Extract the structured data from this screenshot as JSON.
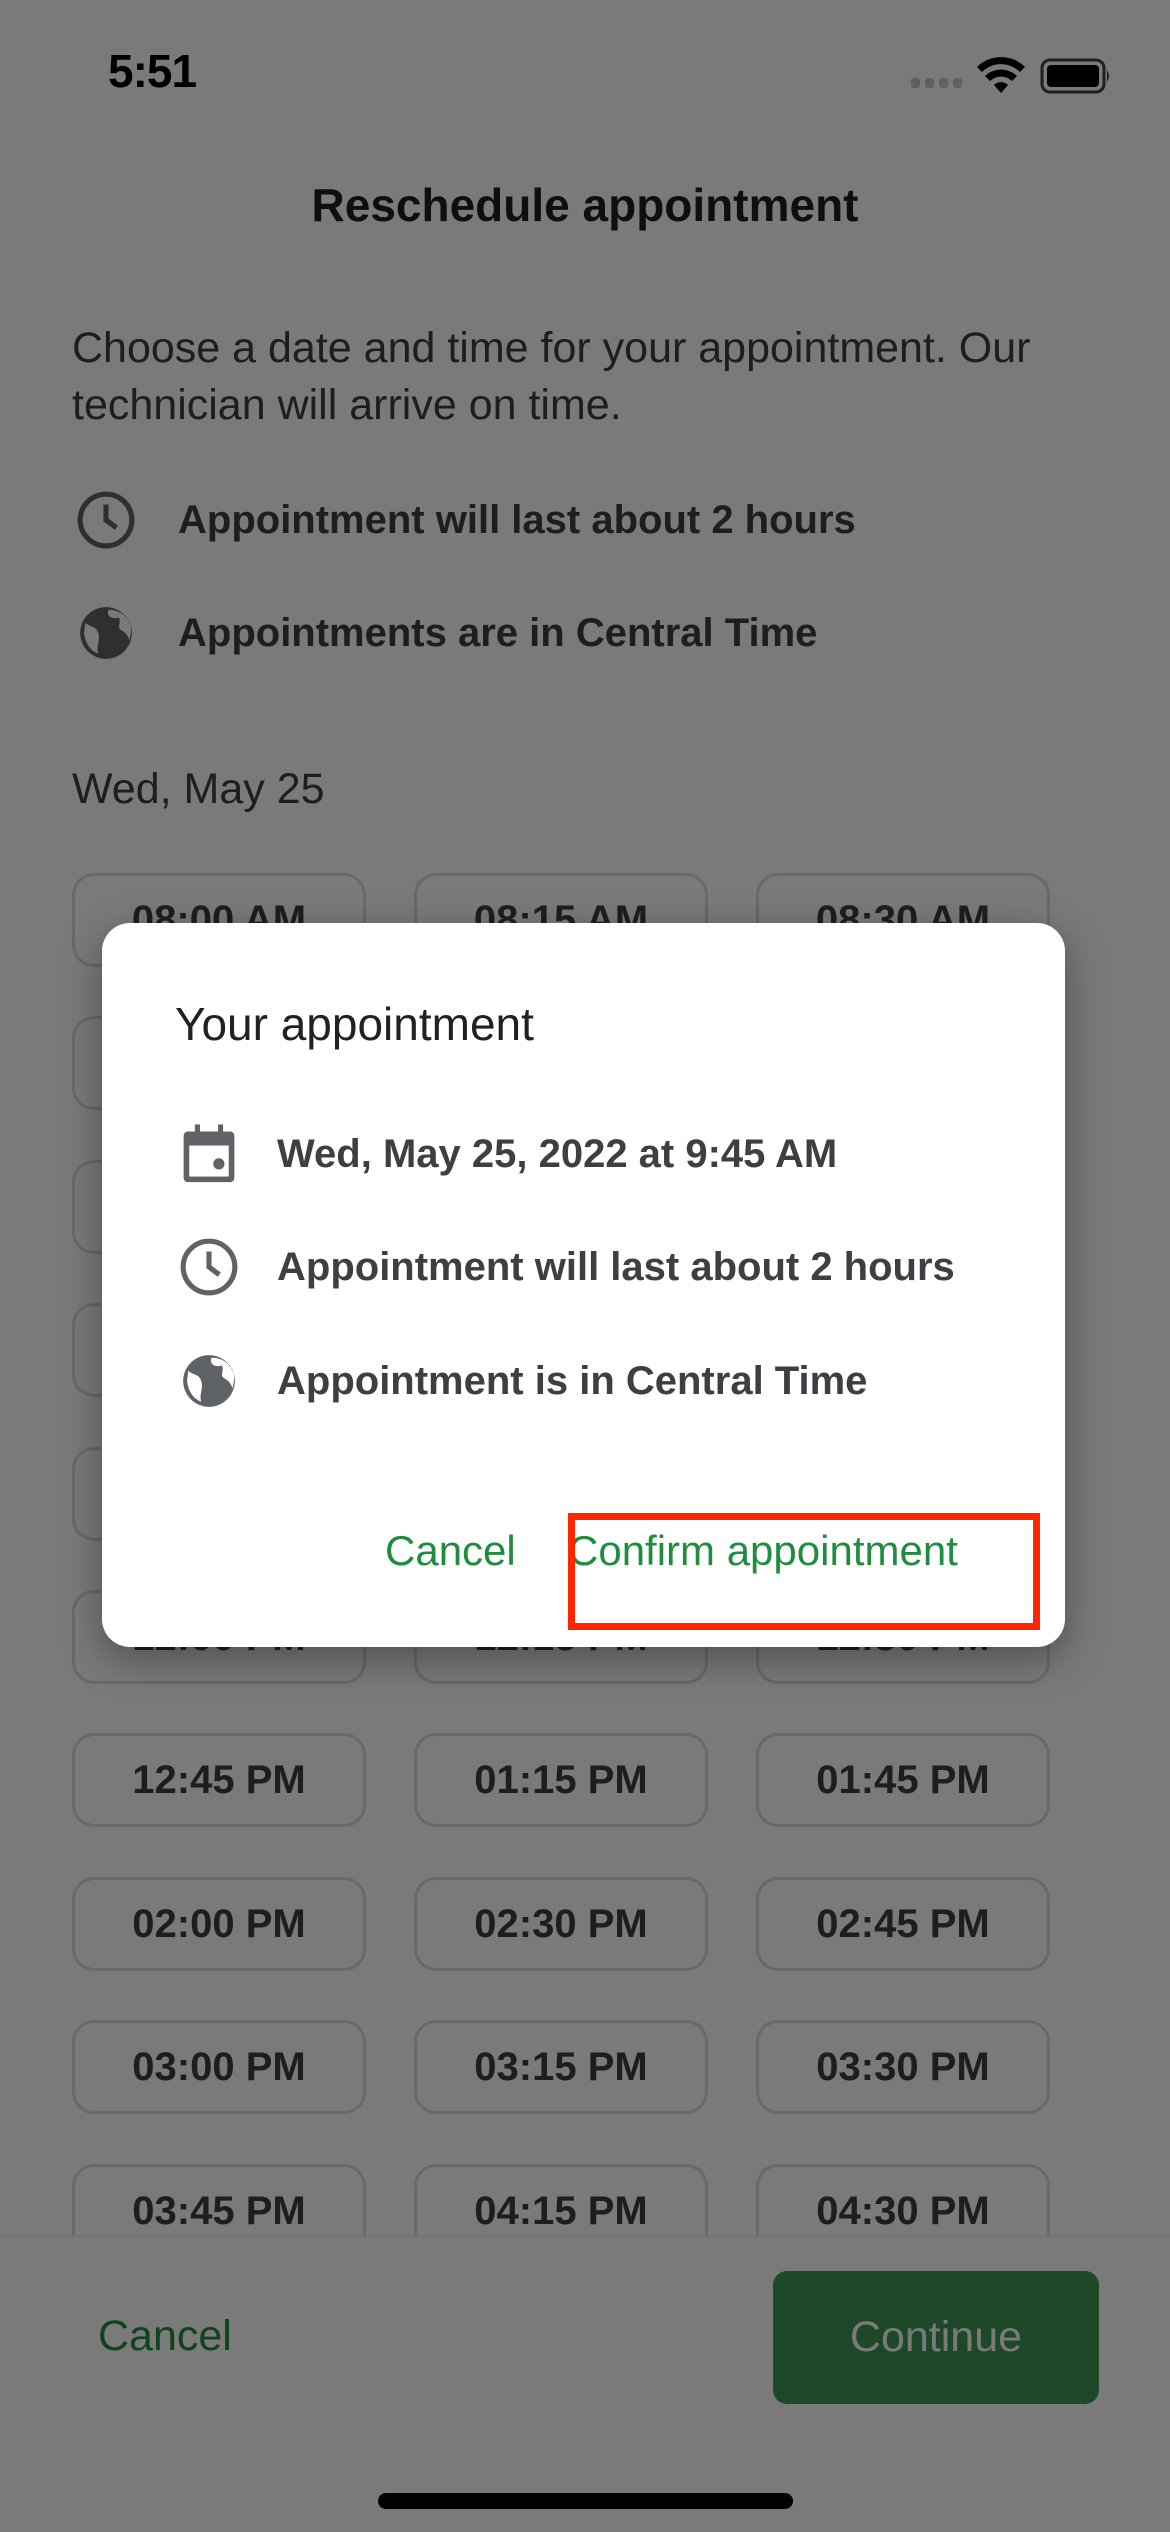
{
  "status_bar": {
    "time": "5:51",
    "icons": [
      "cellular-signal-icon",
      "wifi-icon",
      "battery-icon"
    ]
  },
  "header": {
    "title": "Reschedule appointment"
  },
  "intro": {
    "text": "Choose a date and time for your appointment. Our technician will arrive on time."
  },
  "info": [
    {
      "icon": "clock-icon",
      "text": "Appointment will last about 2 hours"
    },
    {
      "icon": "globe-icon",
      "text": "Appointments are in Central Time"
    }
  ],
  "date_label": "Wed, May 25",
  "time_slots": [
    "08:00 AM",
    "08:15 AM",
    "08:30 AM",
    "",
    "",
    "",
    "",
    "",
    "",
    "",
    "",
    "",
    "",
    "",
    "",
    "12:00 PM",
    "12:15 PM",
    "12:30 PM",
    "12:45 PM",
    "01:15 PM",
    "01:45 PM",
    "02:00 PM",
    "02:30 PM",
    "02:45 PM",
    "03:00 PM",
    "03:15 PM",
    "03:30 PM",
    "03:45 PM",
    "04:15 PM",
    "04:30 PM"
  ],
  "bottom_bar": {
    "cancel_label": "Cancel",
    "continue_label": "Continue"
  },
  "dialog": {
    "title": "Your appointment",
    "rows": [
      {
        "icon": "calendar-icon",
        "text": "Wed, May 25, 2022 at 9:45 AM"
      },
      {
        "icon": "clock-icon",
        "text": "Appointment will last about 2 hours"
      },
      {
        "icon": "globe-icon",
        "text": "Appointment is in Central Time"
      }
    ],
    "cancel_label": "Cancel",
    "confirm_label": "Confirm appointment"
  },
  "colors": {
    "accent_green": "#1e8e3e",
    "highlight_red": "#ff2600",
    "scrim": "rgba(0,0,0,0.52)"
  }
}
